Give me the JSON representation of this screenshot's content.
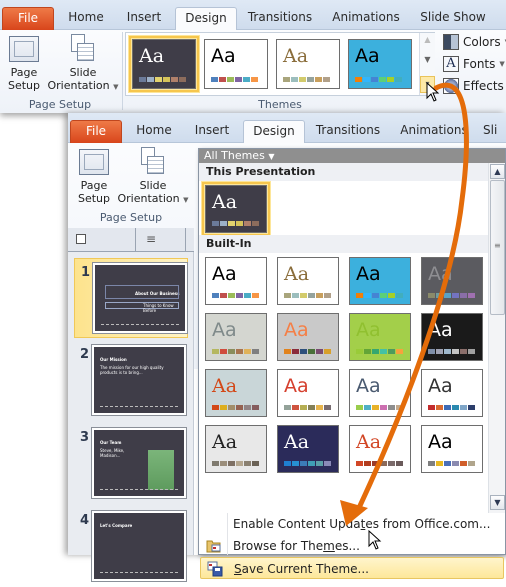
{
  "window_top": {
    "tabs": [
      {
        "label": "File",
        "type": "file"
      },
      {
        "label": "Home"
      },
      {
        "label": "Insert"
      },
      {
        "label": "Design",
        "active": true
      },
      {
        "label": "Transitions"
      },
      {
        "label": "Animations"
      },
      {
        "label": "Slide Show"
      }
    ],
    "page_setup_group": {
      "page_setup_label_1": "Page",
      "page_setup_label_2": "Setup",
      "slide_orientation_label_1": "Slide",
      "slide_orientation_label_2": "Orientation",
      "group_label": "Page Setup"
    },
    "themes_group": {
      "group_label": "Themes",
      "thumbs": [
        {
          "name": "current-dark",
          "aa": "Aa",
          "bg": "#3f3d48",
          "fg": "#ffffff",
          "serif": true,
          "swatches": [
            "#6b7a99",
            "#9cb0c8",
            "#e3d36e",
            "#d6c45a",
            "#b0806a",
            "#8c6c5c"
          ],
          "selected": true
        },
        {
          "name": "office",
          "aa": "Aa",
          "bg": "#ffffff",
          "fg": "#000000",
          "serif": false,
          "swatches": [
            "#4f81bd",
            "#c0504d",
            "#9bbb59",
            "#8064a2",
            "#4bacc6",
            "#f79646"
          ]
        },
        {
          "name": "adjacency",
          "aa": "Aa",
          "bg": "#ffffff",
          "fg": "#8a6d3b",
          "serif": true,
          "swatches": [
            "#a9a57c",
            "#9cbebd",
            "#d2cb6c",
            "#95a39d",
            "#c89f5d",
            "#b1a089"
          ]
        },
        {
          "name": "angles",
          "aa": "Aa",
          "bg": "#3cb0dd",
          "fg": "#000000",
          "serif": false,
          "swatches": [
            "#f07f09",
            "#31b6fd",
            "#4584d3",
            "#5bd078",
            "#a5d028",
            "#41aebd"
          ]
        }
      ]
    },
    "side_commands": [
      {
        "label": "Colors",
        "icon": "colors-icon"
      },
      {
        "label": "Fonts",
        "icon": "fonts-icon"
      },
      {
        "label": "Effects",
        "icon": "effects-icon"
      }
    ]
  },
  "window_bottom": {
    "tabs": [
      {
        "label": "File",
        "type": "file"
      },
      {
        "label": "Home"
      },
      {
        "label": "Insert"
      },
      {
        "label": "Design",
        "active": true
      },
      {
        "label": "Transitions"
      },
      {
        "label": "Animations"
      },
      {
        "label": "Sli"
      }
    ],
    "page_setup_group": {
      "page_setup_label_1": "Page",
      "page_setup_label_2": "Setup",
      "slide_orientation_label_1": "Slide",
      "slide_orientation_label_2": "Orientation",
      "group_label": "Page Setup"
    },
    "slides": [
      {
        "number": "1",
        "title": "About Our Business",
        "subtitle": "Things to Know Before",
        "selected": true
      },
      {
        "number": "2",
        "title": "Our Mission",
        "body": "The mission for our high quality products is to bring..."
      },
      {
        "number": "3",
        "title": "Our Team",
        "body": "Steve, Mike, Madison..."
      },
      {
        "number": "4",
        "title": "Let's Compare"
      }
    ],
    "dropdown": {
      "header": "All Themes",
      "section_this": "This Presentation",
      "section_builtin": "Built-In",
      "this_presentation": {
        "aa": "Aa",
        "bg": "#3f3d48",
        "fg": "#ffffff",
        "serif": true,
        "swatches": [
          "#6b7a99",
          "#9cb0c8",
          "#e3d36e",
          "#d6c45a",
          "#b0806a",
          "#8c6c5c"
        ]
      },
      "builtin_themes": [
        {
          "aa": "Aa",
          "bg": "#ffffff",
          "fg": "#000000",
          "serif": false,
          "swatches": [
            "#4f81bd",
            "#c0504d",
            "#9bbb59",
            "#8064a2",
            "#4bacc6",
            "#f79646"
          ]
        },
        {
          "aa": "Aa",
          "bg": "#ffffff",
          "fg": "#8a6d3b",
          "serif": true,
          "swatches": [
            "#a9a57c",
            "#9cbebd",
            "#d2cb6c",
            "#95a39d",
            "#c89f5d",
            "#b1a089"
          ]
        },
        {
          "aa": "Aa",
          "bg": "#3cb0dd",
          "fg": "#000000",
          "serif": false,
          "swatches": [
            "#f07f09",
            "#31b6fd",
            "#4584d3",
            "#5bd078",
            "#a5d028",
            "#41aebd"
          ]
        },
        {
          "aa": "Aa",
          "bg": "#5b5b60",
          "fg": "#8e8e92",
          "serif": false,
          "swatches": [
            "#8a8a6a",
            "#6f9d9f",
            "#5aa1c4",
            "#7373c0",
            "#8a6ea8",
            "#a070b0"
          ]
        },
        {
          "aa": "Aa",
          "bg": "#d4d6d0",
          "fg": "#7f8a8a",
          "serif": false,
          "swatches": [
            "#b5b75f",
            "#d04c3c",
            "#8a8d5c",
            "#a9744f",
            "#e0b25a",
            "#7f7f7f"
          ]
        },
        {
          "aa": "Aa",
          "bg": "#c9c9c9",
          "fg": "#f57f46",
          "serif": false,
          "swatches": [
            "#e1821d",
            "#8a2a3a",
            "#2d4f7c",
            "#4a6f3a",
            "#7a4a70",
            "#d8a02c"
          ]
        },
        {
          "aa": "Aa",
          "bg": "#a3cf4a",
          "fg": "#90c030",
          "serif": false,
          "swatches": [
            "#99cb38",
            "#63a537",
            "#37a76f",
            "#44c1a3",
            "#4e9b5c",
            "#f7a23d"
          ]
        },
        {
          "aa": "Aa",
          "bg": "#1a1a1a",
          "fg": "#ffffff",
          "serif": false,
          "swatches": [
            "#7f8fa9",
            "#a0a3b4",
            "#9fb8cd",
            "#c3c3c3",
            "#8b6f6b",
            "#a0a0a0"
          ]
        },
        {
          "aa": "Aa",
          "bg": "#c9d6d8",
          "fg": "#d34817",
          "serif": true,
          "swatches": [
            "#d34817",
            "#ddae1d",
            "#a28e6a",
            "#956251",
            "#918485",
            "#855d5d"
          ]
        },
        {
          "aa": "Aa",
          "bg": "#ffffff",
          "fg": "#d5402e",
          "serif": false,
          "swatches": [
            "#93a299",
            "#cf543f",
            "#b5ae53",
            "#848058",
            "#e8b54d",
            "#786c71"
          ]
        },
        {
          "aa": "Aa",
          "bg": "#ffffff",
          "fg": "#4a5a70",
          "serif": false,
          "swatches": [
            "#9acd4c",
            "#4fb0c6",
            "#e8b32a",
            "#cc6fb0",
            "#8e8e8e",
            "#c2a98d"
          ]
        },
        {
          "aa": "Aa",
          "bg": "#ffffff",
          "fg": "#333333",
          "serif": false,
          "swatches": [
            "#c32d2e",
            "#d96a30",
            "#3d6bb5",
            "#2a8ab0",
            "#7fa6c8",
            "#2c3e6b"
          ]
        },
        {
          "aa": "Aa",
          "bg": "#e8e8e8",
          "fg": "#222222",
          "serif": true,
          "swatches": [
            "#7f7a6e",
            "#9b8e7b",
            "#7e7064",
            "#b5a790",
            "#8a8070",
            "#6b6256"
          ]
        },
        {
          "aa": "Aa",
          "bg": "#2b2b5a",
          "fg": "#ffffff",
          "serif": true,
          "swatches": [
            "#1f7fd1",
            "#2790d1",
            "#3c7cb8",
            "#3f9fb6",
            "#5aa0a8",
            "#8a8ab8"
          ]
        },
        {
          "aa": "Aa",
          "bg": "#ffffff",
          "fg": "#d24726",
          "serif": true,
          "swatches": [
            "#d24726",
            "#b23c1e",
            "#9a3b2a",
            "#8c6a5a",
            "#7a6a6a",
            "#6a5a5a"
          ]
        },
        {
          "aa": "Aa",
          "bg": "#ffffff",
          "fg": "#000000",
          "serif": false,
          "swatches": [
            "#7f7f7f",
            "#e8b820",
            "#4a6fb8",
            "#8a8ab0",
            "#d05e2a",
            "#b0a58c"
          ]
        }
      ],
      "menu": [
        {
          "label_pre": "Enable Content Upda",
          "label_u": "t",
          "label_post": "es from Office.com...",
          "icon": null
        },
        {
          "label_pre": "Browse for The",
          "label_u": "m",
          "label_post": "es...",
          "icon": "browse-folder-icon"
        },
        {
          "label_pre": "",
          "label_u": "S",
          "label_post": "ave Current Theme...",
          "icon": "save-theme-icon",
          "hover": true
        }
      ]
    }
  },
  "annotation": {
    "arrow_color": "#e46c0a"
  }
}
